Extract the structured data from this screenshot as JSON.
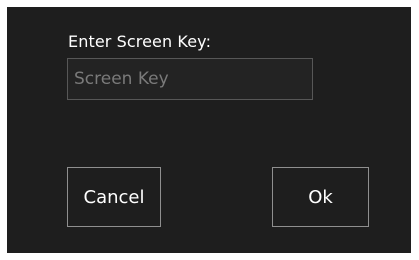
{
  "dialog": {
    "prompt_label": "Enter Screen Key:",
    "key_input": {
      "value": "",
      "placeholder": "Screen Key"
    },
    "cancel_label": "Cancel",
    "ok_label": "Ok"
  },
  "colors": {
    "dialog_background": "#1e1e1e",
    "text": "#ffffff",
    "placeholder_text": "#7a7a7a",
    "input_border": "#575757",
    "button_border": "#8f8f8f"
  }
}
